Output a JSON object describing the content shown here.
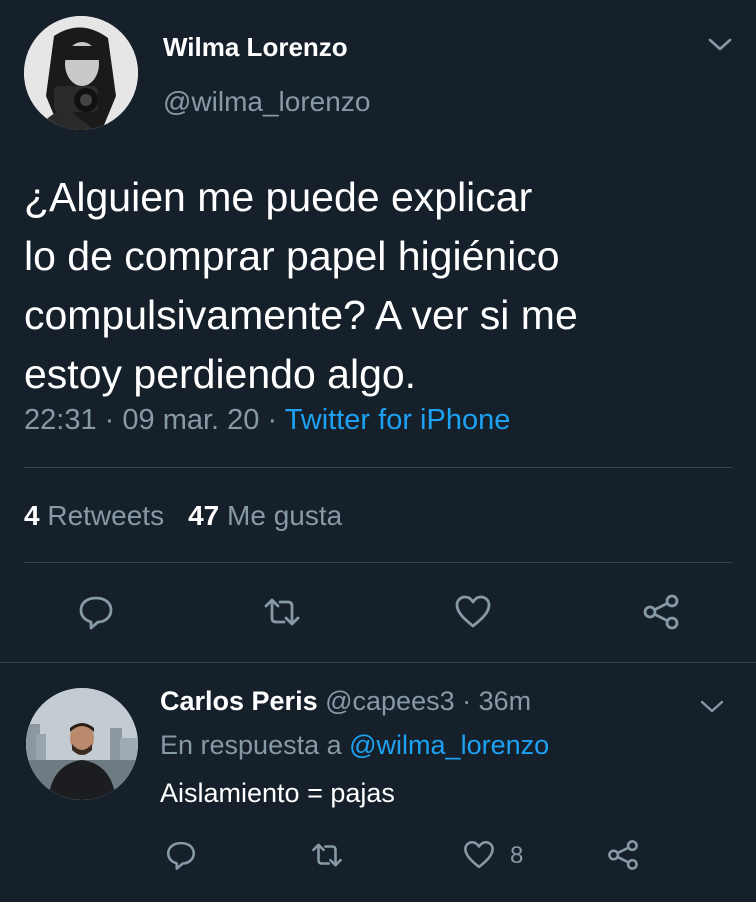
{
  "main_tweet": {
    "author_name": "Wilma Lorenzo",
    "author_handle": "@wilma_lorenzo",
    "text_lines": [
      "¿Alguien me puede explicar",
      "lo de comprar papel higiénico",
      "compulsivamente? A ver si me",
      "estoy perdiendo algo."
    ],
    "time": "22:31",
    "sep": "·",
    "date": "09 mar. 20",
    "source": "Twitter for iPhone",
    "retweets_count": "4",
    "retweets_label": "Retweets",
    "likes_count": "47",
    "likes_label": "Me gusta",
    "actions": [
      "reply-icon",
      "retweet-icon",
      "like-icon",
      "share-icon"
    ]
  },
  "reply": {
    "author_name": "Carlos Peris",
    "author_handle": "@capees3",
    "sep": "·",
    "age": "36m",
    "reply_to_prefix": "En respuesta a",
    "reply_to_handle": "@wilma_lorenzo",
    "text": "Aislamiento = pajas",
    "like_count": "8"
  },
  "colors": {
    "background": "#15202b",
    "text": "#ffffff",
    "muted": "#8899a6",
    "accent": "#1da1f2",
    "divider": "#38444d"
  }
}
